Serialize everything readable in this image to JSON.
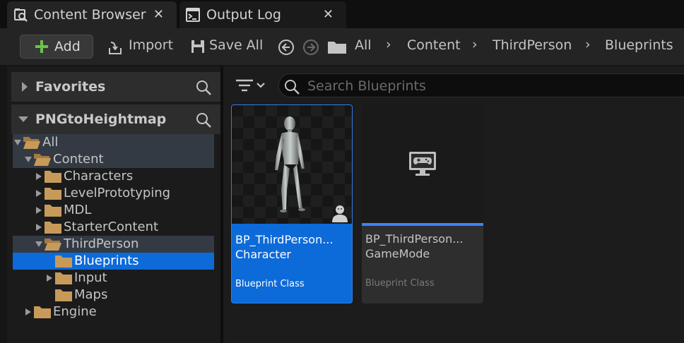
{
  "tabs": [
    {
      "label": "Content Browser",
      "active": true,
      "icon": "content-browser-icon"
    },
    {
      "label": "Output Log",
      "active": false,
      "icon": "terminal-icon"
    }
  ],
  "tab_close_glyph": "✕",
  "toolbar": {
    "add_label": "Add",
    "import_label": "Import",
    "save_all_label": "Save All",
    "breadcrumb": [
      "All",
      "Content",
      "ThirdPerson",
      "Blueprints"
    ],
    "crumb_separator": "›"
  },
  "left_panel": {
    "favorites_label": "Favorites",
    "project_label": "PNGtoHeightmap",
    "tree": [
      {
        "label": "All",
        "depth": 0,
        "expanded": true,
        "has_arrow": true
      },
      {
        "label": "Content",
        "depth": 1,
        "expanded": true,
        "has_arrow": true
      },
      {
        "label": "Characters",
        "depth": 2,
        "expanded": false,
        "has_arrow": true
      },
      {
        "label": "LevelPrototyping",
        "depth": 2,
        "expanded": false,
        "has_arrow": true
      },
      {
        "label": "MDL",
        "depth": 2,
        "expanded": false,
        "has_arrow": true
      },
      {
        "label": "StarterContent",
        "depth": 2,
        "expanded": false,
        "has_arrow": true
      },
      {
        "label": "ThirdPerson",
        "depth": 2,
        "expanded": true,
        "has_arrow": true
      },
      {
        "label": "Blueprints",
        "depth": 3,
        "expanded": false,
        "has_arrow": false,
        "selected": true
      },
      {
        "label": "Input",
        "depth": 3,
        "expanded": false,
        "has_arrow": true
      },
      {
        "label": "Maps",
        "depth": 3,
        "expanded": false,
        "has_arrow": false
      },
      {
        "label": "Engine",
        "depth": 1,
        "expanded": false,
        "has_arrow": true
      }
    ]
  },
  "content": {
    "search_placeholder": "Search Blueprints",
    "assets": [
      {
        "name_line1": "BP_ThirdPerson...",
        "name_line2": "Character",
        "type": "Blueprint Class",
        "selected": true,
        "thumbnail": "mannequin-thumbnail",
        "badge_icon": "character-badge-icon"
      },
      {
        "name_line1": "BP_ThirdPerson...",
        "name_line2": "GameMode",
        "type": "Blueprint Class",
        "selected": false,
        "thumbnail": "gamemode-thumbnail",
        "badge_icon": "gamepad-monitor-icon"
      }
    ]
  },
  "colors": {
    "selection": "#0d6ad9",
    "folder": "#c89a5a",
    "add_plus": "#6ac34a"
  }
}
